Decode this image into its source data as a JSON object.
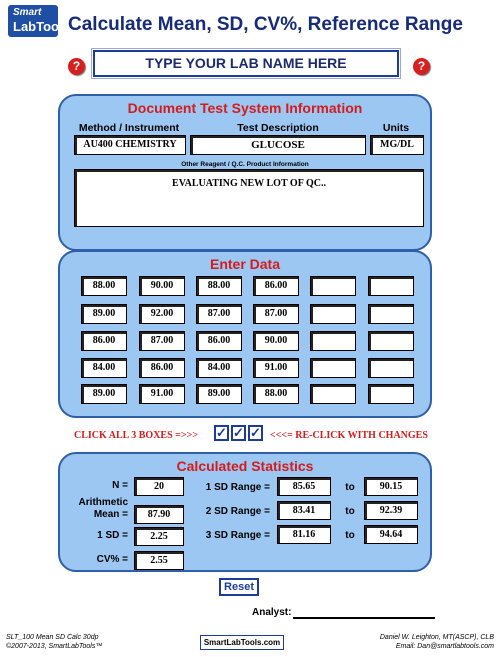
{
  "logo": {
    "line1": "Smart",
    "line2": "LabTools"
  },
  "title": "Calculate Mean, SD, CV%, Reference Range",
  "help_icon": "?",
  "lab_name": "TYPE YOUR LAB NAME HERE",
  "system_info": {
    "title": "Document Test System Information",
    "method_label": "Method / Instrument",
    "test_label": "Test Description",
    "units_label": "Units",
    "method_value": "AU400 CHEMISTRY",
    "test_value": "GLUCOSE",
    "units_value": "MG/DL",
    "reagent_label": "Other Reagent / Q.C. Product Information",
    "reagent_value": "EVALUATING NEW LOT OF QC.."
  },
  "enter_data": {
    "title": "Enter Data",
    "rows": [
      [
        "88.00",
        "90.00",
        "88.00",
        "86.00",
        "",
        ""
      ],
      [
        "89.00",
        "92.00",
        "87.00",
        "87.00",
        "",
        ""
      ],
      [
        "86.00",
        "87.00",
        "86.00",
        "90.00",
        "",
        ""
      ],
      [
        "84.00",
        "86.00",
        "84.00",
        "91.00",
        "",
        ""
      ],
      [
        "89.00",
        "91.00",
        "89.00",
        "88.00",
        "",
        ""
      ]
    ]
  },
  "instructions": {
    "left": "CLICK ALL 3 BOXES =>>>",
    "right": "<<<= RE-CLICK WITH CHANGES",
    "check_mark": "✓"
  },
  "stats": {
    "title": "Calculated Statistics",
    "n_label": "N =",
    "n_value": "20",
    "mean_label_1": "Arithmetic",
    "mean_label_2": "Mean =",
    "mean_value": "87.90",
    "sd_label": "1 SD =",
    "sd_value": "2.25",
    "cv_label": "CV% =",
    "cv_value": "2.55",
    "range1_label": "1 SD Range =",
    "range1_low": "85.65",
    "range1_high": "90.15",
    "range2_label": "2 SD Range =",
    "range2_low": "83.41",
    "range2_high": "92.39",
    "range3_label": "3 SD Range =",
    "range3_low": "81.16",
    "range3_high": "94.64",
    "to_label": "to"
  },
  "reset_label": "Reset",
  "analyst_label": "Analyst:",
  "footer": {
    "left_line1": "SLT_100 Mean SD Calc 30dp",
    "left_line2": "©2007-2013, SmartLabTools™",
    "center": "SmartLabTools.com",
    "right_line1": "Daniel W. Leighton, MT(ASCP), CLB",
    "right_line2": "Email: Dan@smartlabtools.com"
  }
}
